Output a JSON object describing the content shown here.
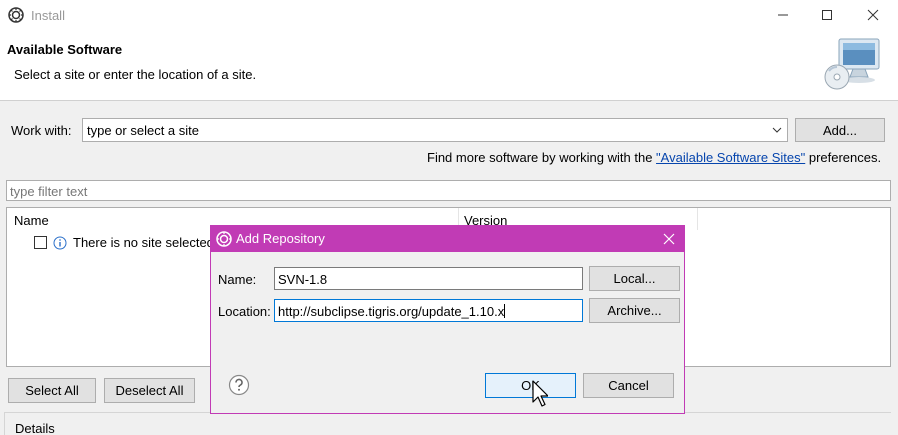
{
  "window": {
    "title": "Install",
    "header_title": "Available Software",
    "header_subtitle": "Select a site or enter the location of a site."
  },
  "workwith": {
    "label": "Work with:",
    "value": "type or select a site",
    "add_label": "Add..."
  },
  "findmore": {
    "prefix": "Find more software by working with the ",
    "link": "\"Available Software Sites\"",
    "suffix": " preferences."
  },
  "filter": {
    "placeholder": "type filter text"
  },
  "tree": {
    "columns": [
      "Name",
      "Version"
    ],
    "rows": [
      {
        "label": "There is no site selected"
      }
    ]
  },
  "buttons": {
    "select_all": "Select All",
    "deselect_all": "Deselect All"
  },
  "details_label": "Details",
  "dialog": {
    "title": "Add Repository",
    "name_label": "Name:",
    "name_value": "SVN-1.8",
    "location_label": "Location:",
    "location_value": "http://subclipse.tigris.org/update_1.10.x",
    "local_label": "Local...",
    "archive_label": "Archive...",
    "ok_label": "OK",
    "cancel_label": "Cancel",
    "accent_color": "#c13bb5"
  },
  "icons": [
    "eclipse-icon",
    "minimize-icon",
    "maximize-icon",
    "close-icon",
    "install-banner-icon",
    "dropdown-icon",
    "info-icon",
    "help-icon",
    "pointer-cursor-icon"
  ]
}
